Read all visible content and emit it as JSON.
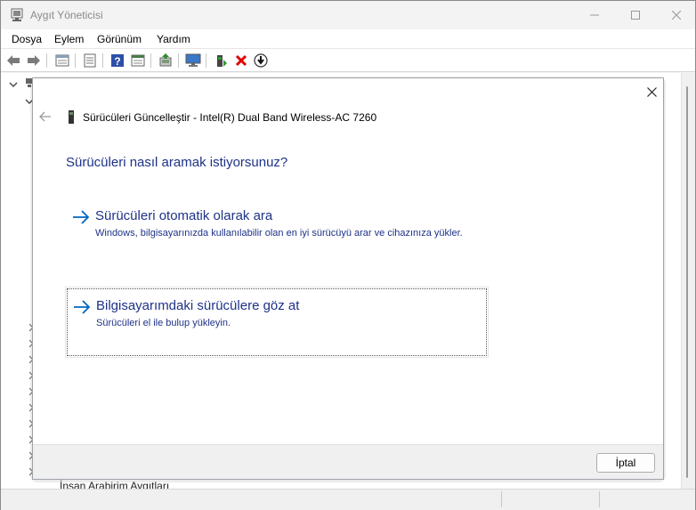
{
  "window": {
    "title": "Aygıt Yöneticisi",
    "icon": "device-manager-icon"
  },
  "menu": {
    "items": [
      "Dosya",
      "Eylem",
      "Görünüm",
      "Yardım"
    ]
  },
  "toolbar": {
    "icons": [
      "back-arrow-icon",
      "forward-arrow-icon",
      "properties-icon",
      "list-view-icon",
      "help-icon",
      "details-icon",
      "update-driver-icon",
      "monitor-icon",
      "add-hardware-icon",
      "remove-icon",
      "download-icon"
    ]
  },
  "tree": {
    "last_visible_item": "İnsan Arabirim Aygıtları"
  },
  "dialog": {
    "title": "Sürücüleri Güncelleştir - Intel(R) Dual Band Wireless-AC 7260",
    "heading": "Sürücüleri nasıl aramak istiyorsunuz?",
    "options": [
      {
        "title": "Sürücüleri otomatik olarak ara",
        "description": "Windows, bilgisayarınızda kullanılabilir olan en iyi sürücüyü arar ve cihazınıza yükler."
      },
      {
        "title": "Bilgisayarımdaki sürücülere göz at",
        "description": "Sürücüleri el ile bulup yükleyin."
      }
    ],
    "cancel_label": "İptal"
  },
  "colors": {
    "link_blue": "#1e3287",
    "arrow_blue": "#0067c0",
    "remove_red": "#e00000"
  }
}
